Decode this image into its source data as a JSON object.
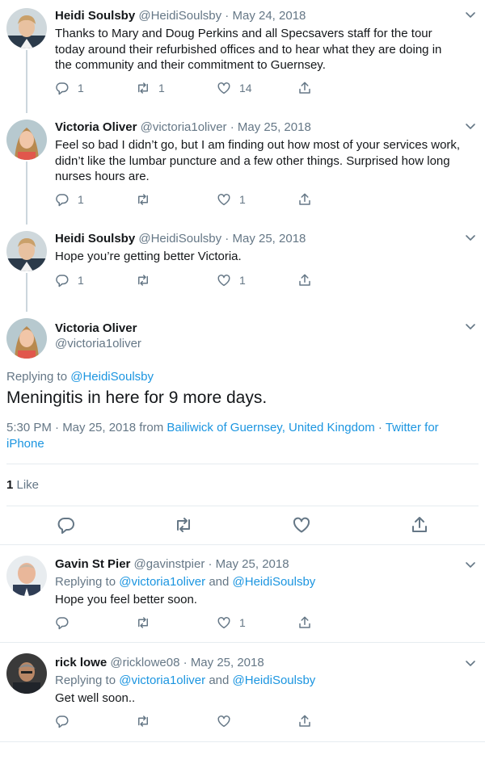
{
  "colors": {
    "link": "#1b95e0",
    "secondary": "#657786",
    "divider": "#e6ecf0"
  },
  "tweets": [
    {
      "name": "Heidi Soulsby",
      "handle": "@HeidiSoulsby",
      "sep": " · ",
      "date": "May 24, 2018",
      "lines": [
        "Thanks to Mary and Doug Perkins and all  Specsavers staff for the tour",
        "today around their refurbished offices and to hear what they are doing in",
        "the community and their commitment to Guernsey."
      ],
      "replies": "1",
      "retweets": "1",
      "likes": "14"
    },
    {
      "name": "Victoria Oliver",
      "handle": "@victoria1oliver",
      "sep": " · ",
      "date": "May 25, 2018",
      "lines": [
        "Feel so bad I didn’t go, but I am finding out how most of your services work,",
        "didn’t like the lumbar puncture and a few other things. Surprised how long",
        "nurses hours are."
      ],
      "replies": "1",
      "retweets": "",
      "likes": "1"
    },
    {
      "name": "Heidi Soulsby",
      "handle": "@HeidiSoulsby",
      "sep": " · ",
      "date": "May 25, 2018",
      "lines": [
        "Hope you’re getting better Victoria."
      ],
      "replies": "1",
      "retweets": "",
      "likes": "1"
    }
  ],
  "focused": {
    "name": "Victoria Oliver",
    "handle": "@victoria1oliver",
    "replying_label": "Replying to ",
    "replying_to": "@HeidiSoulsby",
    "text": "Meningitis in here for 9 more days.",
    "time": "5:30 PM · May 25, 2018 from ",
    "location": "Bailiwick of Guernsey, United Kingdom",
    "sep": " · ",
    "source_line1": "Twitter for",
    "source_line2": "iPhone",
    "likes_count": "1",
    "likes_label": " Like"
  },
  "replies": [
    {
      "name": "Gavin St Pier",
      "handle": "@gavinstpier",
      "sep": " · ",
      "date": "May 25, 2018",
      "replying_label": "Replying to ",
      "replying_a": "@victoria1oliver",
      "and": " and ",
      "replying_b": "@HeidiSoulsby",
      "text": "Hope you feel better soon.",
      "replies": "",
      "retweets": "",
      "likes": "1"
    },
    {
      "name": "rick lowe",
      "handle": "@ricklowe08",
      "sep": " · ",
      "date": "May 25, 2018",
      "replying_label": "Replying to ",
      "replying_a": "@victoria1oliver",
      "and": " and ",
      "replying_b": "@HeidiSoulsby",
      "text": "Get well soon..",
      "replies": "",
      "retweets": "",
      "likes": ""
    }
  ]
}
